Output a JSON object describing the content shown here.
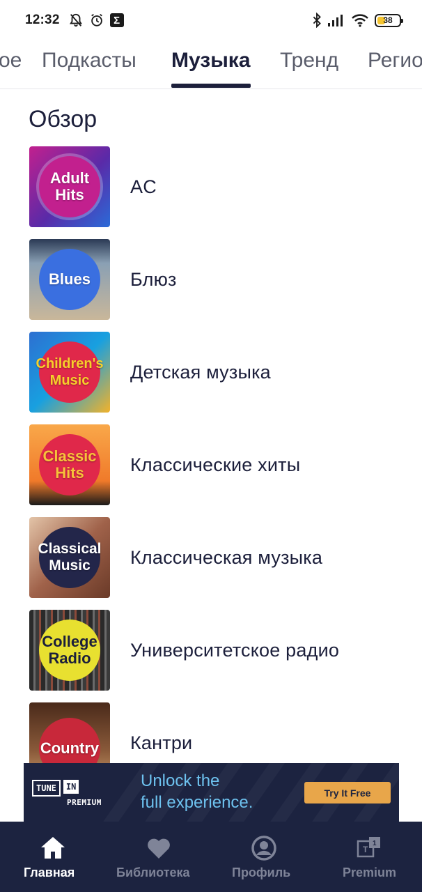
{
  "status_bar": {
    "time": "12:32",
    "battery": "38",
    "battery_level": 0.38
  },
  "tabs": [
    {
      "label": "ое"
    },
    {
      "label": "Подкасты"
    },
    {
      "label": "Музыка",
      "active": true
    },
    {
      "label": "Тренд"
    },
    {
      "label": "Регио"
    }
  ],
  "section": {
    "title": "Обзор"
  },
  "genres": [
    {
      "name": "AC",
      "art": "Adult\nHits",
      "bg": "#3c2a8e",
      "circle": "#c2208e"
    },
    {
      "name": "Блюз",
      "art": "Blues",
      "bg": "#6f8aa3",
      "circle": "#3a6fe0"
    },
    {
      "name": "Детская музыка",
      "art": "Children's\nMusic",
      "bg": "#2d6fd1",
      "circle": "#e0284a"
    },
    {
      "name": "Классические хиты",
      "art": "Classic\nHits",
      "bg": "#f08a2a",
      "circle": "#e0284a"
    },
    {
      "name": "Классическая музыка",
      "art": "Classical\nMusic",
      "bg": "#a0624a",
      "circle": "#23264a"
    },
    {
      "name": "Университетское радио",
      "art": "College\nRadio",
      "bg": "#3a3a3a",
      "circle": "#e8e030"
    },
    {
      "name": "Кантри",
      "art": "Country",
      "bg": "#7a4a30",
      "circle": "#c8283a"
    }
  ],
  "banner": {
    "tune": "TUNE",
    "in": "IN",
    "premium": "PREMIUM",
    "headline": "Unlock the\nfull experience.",
    "cta": "Try It Free"
  },
  "bottom_nav": [
    {
      "label": "Главная",
      "icon": "home-icon",
      "active": true
    },
    {
      "label": "Библиотека",
      "icon": "heart-icon"
    },
    {
      "label": "Профиль",
      "icon": "profile-icon"
    },
    {
      "label": "Premium",
      "icon": "premium-icon"
    }
  ],
  "colors": {
    "nav_bg": "#1c2340",
    "accent": "#1c1f3b",
    "cta": "#e8a64a",
    "banner_text": "#6ec2ef"
  }
}
